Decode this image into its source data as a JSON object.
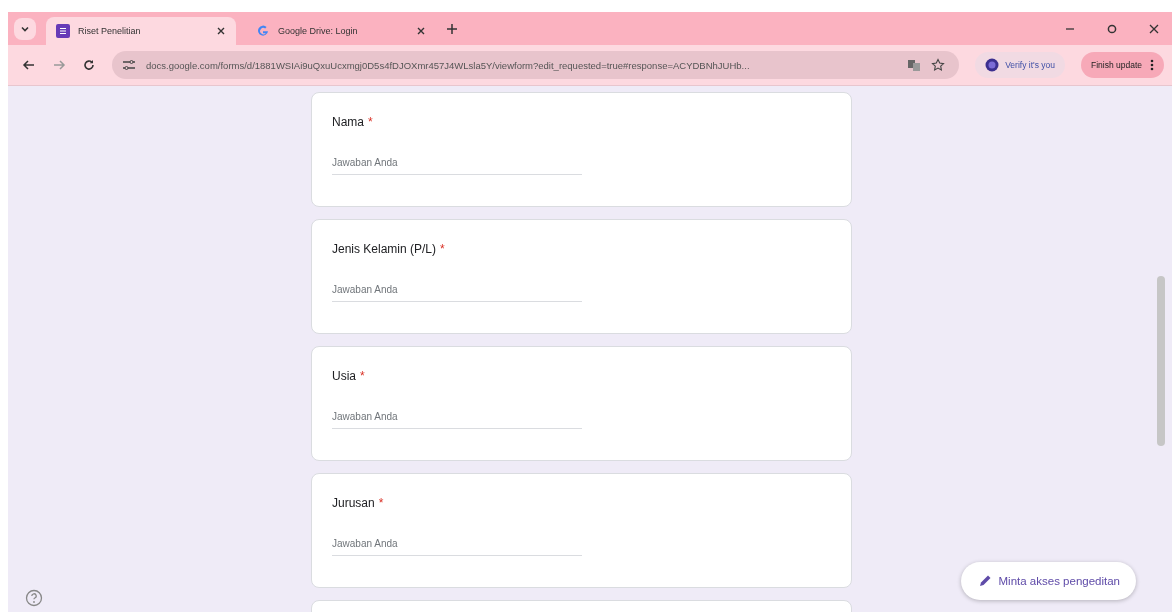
{
  "tabs": [
    {
      "title": "Riset Penelitian",
      "selected": true
    },
    {
      "title": "Google Drive: Login",
      "selected": false
    }
  ],
  "address_bar": {
    "url": "docs.google.com/forms/d/1881WSIAi9uQxuUcxmgj0D5s4fDJOXmr457J4WLsla5Y/viewform?edit_requested=true#response=ACYDBNhJUHb..."
  },
  "profile_chip": {
    "label": "Verify it's you"
  },
  "update_button": {
    "label": "Finish update"
  },
  "questions": [
    {
      "title": "Nama",
      "required_mark": "*",
      "placeholder": "Jawaban Anda"
    },
    {
      "title": "Jenis Kelamin (P/L)",
      "required_mark": "*",
      "placeholder": "Jawaban Anda"
    },
    {
      "title": "Usia",
      "required_mark": "*",
      "placeholder": "Jawaban Anda"
    },
    {
      "title": "Jurusan",
      "required_mark": "*",
      "placeholder": "Jawaban Anda"
    }
  ],
  "edit_access_button": {
    "label": "Minta akses pengeditan"
  }
}
